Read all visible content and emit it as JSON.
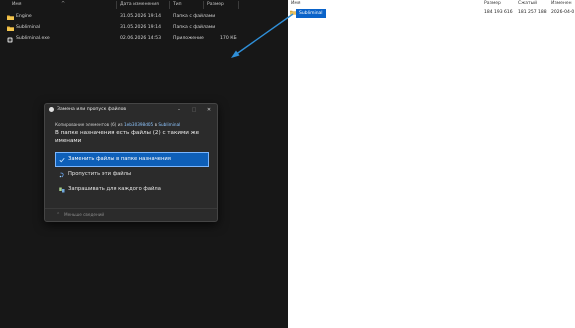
{
  "left_explorer": {
    "columns": {
      "name": "Имя",
      "date": "Дата изменения",
      "type": "Тип",
      "size": "Размер"
    },
    "rows": [
      {
        "name": "Engine",
        "date": "31.05.2026 19:14",
        "type": "Папка с файлами",
        "size": "",
        "icon": "folder-icon"
      },
      {
        "name": "Subliminal",
        "date": "31.05.2026 19:14",
        "type": "Папка с файлами",
        "size": "",
        "icon": "folder-icon"
      },
      {
        "name": "Subliminal.exe",
        "date": "02.06.2026 14:53",
        "type": "Приложение",
        "size": "170 КБ",
        "icon": "exe-icon"
      }
    ]
  },
  "right_explorer": {
    "columns": {
      "name": "Имя",
      "size": "Размер",
      "compressed": "Сжатый",
      "modified": "Изменен"
    },
    "rows": [
      {
        "name": "Subliminal",
        "size": "184 193 616",
        "compressed": "181 257 188",
        "modified": "2026-04-0",
        "selected": true
      }
    ]
  },
  "dialog": {
    "title": "Замена или пропуск файлов",
    "info_prefix": "Копирование элементов (6) из",
    "info_source": "1eb30398d05",
    "info_mid": "в",
    "info_dest": "Subliminal",
    "heading": "В папке назначения есть файлы (2) с такими же именами",
    "options": [
      {
        "label": "Заменить файлы в папке назначения",
        "icon": "check-icon",
        "selected": true
      },
      {
        "label": "Пропустить эти файлы",
        "icon": "skip-icon",
        "selected": false
      },
      {
        "label": "Запрашивать для каждого файла",
        "icon": "compare-icon",
        "selected": false
      }
    ],
    "details_label": "Меньше сведений",
    "minimize_glyph": "–",
    "maximize_glyph": "□",
    "close_glyph": "✕",
    "details_glyph": "⌃"
  },
  "colors": {
    "dark_bg": "#171717",
    "selected_option": "#0e5fb8",
    "arrow": "#2f8fd8",
    "selection_highlight": "#0a63c9"
  }
}
